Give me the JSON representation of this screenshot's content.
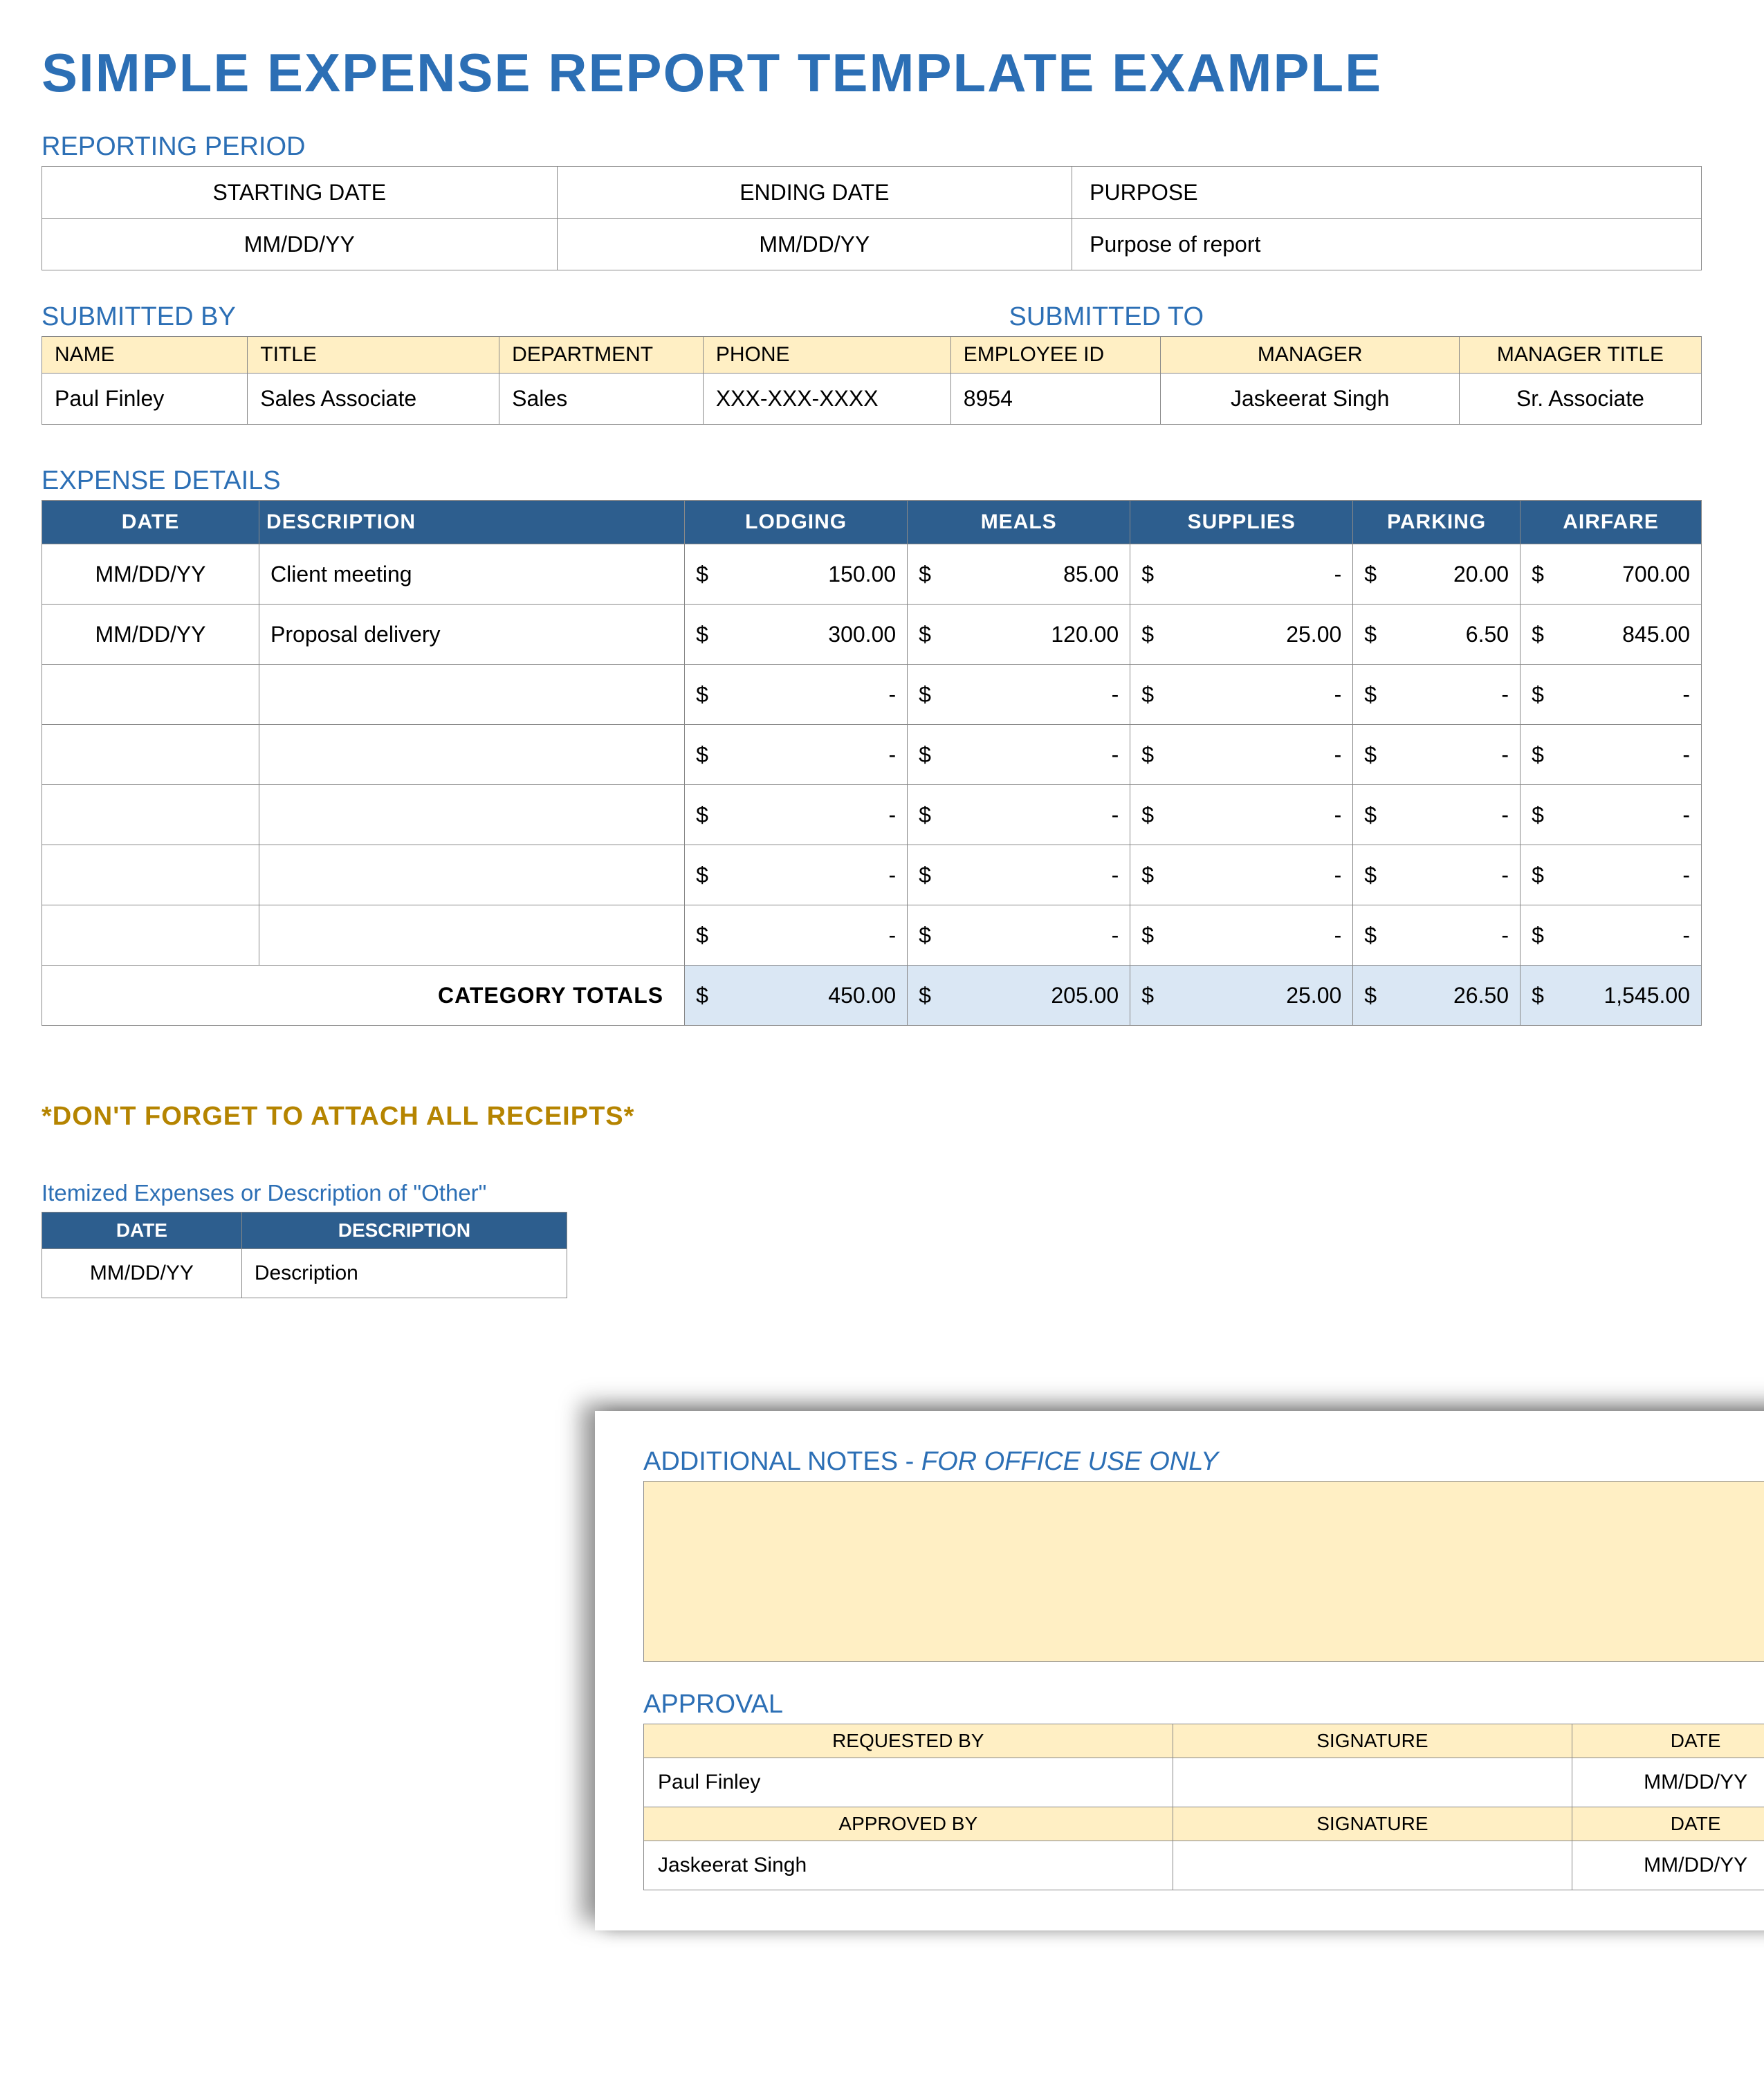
{
  "title": "SIMPLE EXPENSE REPORT TEMPLATE EXAMPLE",
  "period": {
    "label": "REPORTING PERIOD",
    "headers": {
      "start": "STARTING DATE",
      "end": "ENDING DATE",
      "purpose": "PURPOSE"
    },
    "values": {
      "start": "MM/DD/YY",
      "end": "MM/DD/YY",
      "purpose": "Purpose of report"
    }
  },
  "submitted": {
    "by_label": "SUBMITTED BY",
    "to_label": "SUBMITTED TO",
    "headers": {
      "name": "NAME",
      "title": "TITLE",
      "dept": "DEPARTMENT",
      "phone": "PHONE",
      "empid": "EMPLOYEE ID",
      "manager": "MANAGER",
      "manager_title": "MANAGER TITLE"
    },
    "values": {
      "name": "Paul Finley",
      "title": "Sales Associate",
      "dept": "Sales",
      "phone": "XXX-XXX-XXXX",
      "empid": "8954",
      "manager": "Jaskeerat Singh",
      "manager_title": "Sr. Associate"
    }
  },
  "expenses": {
    "label": "EXPENSE DETAILS",
    "headers": {
      "date": "DATE",
      "desc": "DESCRIPTION",
      "lodging": "LODGING",
      "meals": "MEALS",
      "supplies": "SUPPLIES",
      "parking": "PARKING",
      "airfare": "AIRFARE"
    },
    "currency": "$",
    "dash": "-",
    "rows": [
      {
        "date": "MM/DD/YY",
        "desc": "Client meeting",
        "lodging": "150.00",
        "meals": "85.00",
        "supplies": "-",
        "parking": "20.00",
        "airfare": "700.00"
      },
      {
        "date": "MM/DD/YY",
        "desc": "Proposal delivery",
        "lodging": "300.00",
        "meals": "120.00",
        "supplies": "25.00",
        "parking": "6.50",
        "airfare": "845.00"
      },
      {
        "date": "",
        "desc": "",
        "lodging": "-",
        "meals": "-",
        "supplies": "-",
        "parking": "-",
        "airfare": "-"
      },
      {
        "date": "",
        "desc": "",
        "lodging": "-",
        "meals": "-",
        "supplies": "-",
        "parking": "-",
        "airfare": "-"
      },
      {
        "date": "",
        "desc": "",
        "lodging": "-",
        "meals": "-",
        "supplies": "-",
        "parking": "-",
        "airfare": "-"
      },
      {
        "date": "",
        "desc": "",
        "lodging": "-",
        "meals": "-",
        "supplies": "-",
        "parking": "-",
        "airfare": "-"
      },
      {
        "date": "",
        "desc": "",
        "lodging": "-",
        "meals": "-",
        "supplies": "-",
        "parking": "-",
        "airfare": "-"
      }
    ],
    "totals_label": "CATEGORY TOTALS",
    "totals": {
      "lodging": "450.00",
      "meals": "205.00",
      "supplies": "25.00",
      "parking": "26.50",
      "airfare": "1,545.00"
    }
  },
  "receipts_note": "*DON'T FORGET TO ATTACH ALL RECEIPTS*",
  "itemized": {
    "label": "Itemized Expenses or Description of \"Other\"",
    "headers": {
      "date": "DATE",
      "desc": "DESCRIPTION"
    },
    "rows": [
      {
        "date": "MM/DD/YY",
        "desc": "Description"
      }
    ]
  },
  "overlay": {
    "notes_label_a": "ADDITIONAL NOTES - ",
    "notes_label_b": "FOR OFFICE USE ONLY",
    "approval_label": "APPROVAL",
    "approval": {
      "headers1": {
        "req": "REQUESTED BY",
        "sig": "SIGNATURE",
        "date": "DATE"
      },
      "row1": {
        "req": "Paul Finley",
        "sig": "",
        "date": "MM/DD/YY"
      },
      "headers2": {
        "req": "APPROVED BY",
        "sig": "SIGNATURE",
        "date": "DATE"
      },
      "row2": {
        "req": "Jaskeerat Singh",
        "sig": "",
        "date": "MM/DD/YY"
      }
    }
  }
}
